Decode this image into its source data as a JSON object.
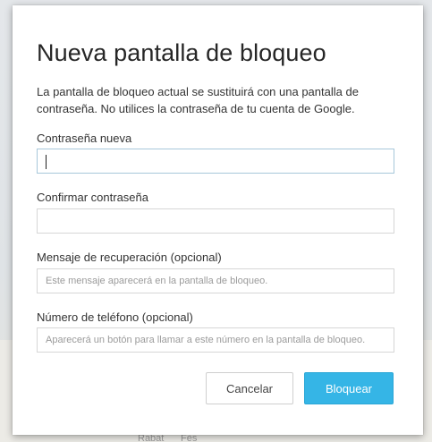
{
  "background": {
    "cities": [
      "Rabat",
      "Fès"
    ]
  },
  "dialog": {
    "title": "Nueva pantalla de bloqueo",
    "description": "La pantalla de bloqueo actual se sustituirá con una pantalla de contraseña. No utilices la contraseña de tu cuenta de Google.",
    "fields": [
      {
        "label": "Contraseña nueva",
        "value": "",
        "placeholder": ""
      },
      {
        "label": "Confirmar contraseña",
        "value": "",
        "placeholder": ""
      },
      {
        "label": "Mensaje de recuperación (opcional)",
        "value": "",
        "placeholder": "Este mensaje aparecerá en la pantalla de bloqueo."
      },
      {
        "label": "Número de teléfono (opcional)",
        "value": "",
        "placeholder": "Aparecerá un botón para llamar a este número en la pantalla de bloqueo."
      }
    ],
    "buttons": {
      "cancel": "Cancelar",
      "confirm": "Bloquear"
    }
  },
  "colors": {
    "primary_button": "#35b5e6",
    "focus_border": "#a7c7da"
  }
}
